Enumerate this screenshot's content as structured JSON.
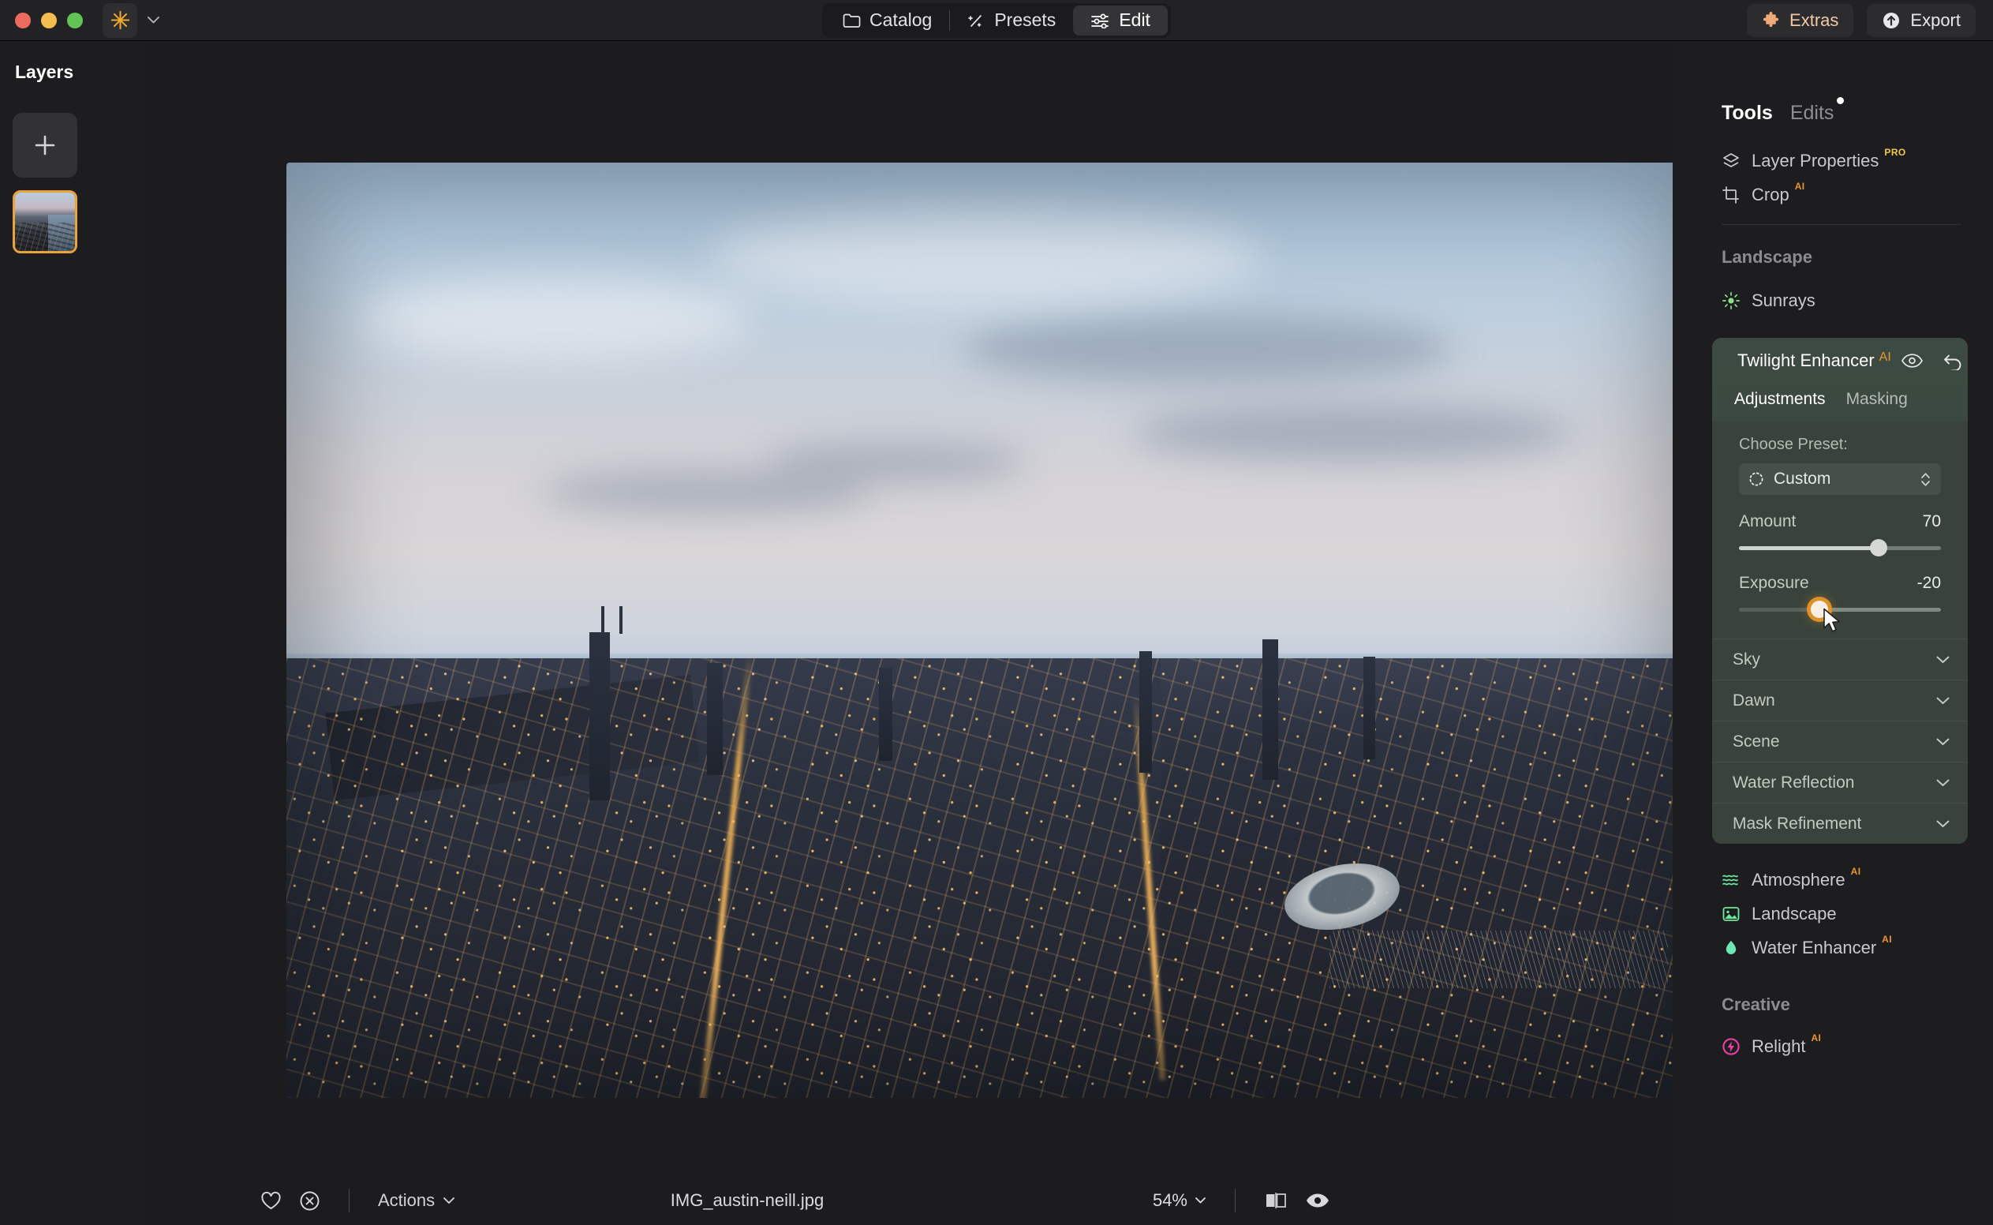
{
  "window": {
    "traffic_lights": [
      "close",
      "minimize",
      "zoom"
    ],
    "app_icon": "sparkle-icon",
    "app_menu_chevron": "chevron-down-icon"
  },
  "topnav": {
    "items": [
      {
        "label": "Catalog",
        "icon": "folder-icon",
        "active": false
      },
      {
        "label": "Presets",
        "icon": "wand-sparkle-icon",
        "active": false
      },
      {
        "label": "Edit",
        "icon": "sliders-icon",
        "active": true
      }
    ],
    "extras_label": "Extras",
    "extras_icon": "puzzle-piece-icon",
    "export_label": "Export",
    "export_icon": "upload-circle-icon"
  },
  "layers": {
    "title": "Layers",
    "add_label": "+",
    "add_name": "add-layer-button",
    "selected_layer_border": "#e8a33d"
  },
  "canvas": {
    "image_description": "Aerial twilight view of Chicago skyline with Lake Michigan"
  },
  "bottombar": {
    "favorite_icon": "heart-icon",
    "reject_icon": "reject-circle-icon",
    "actions_label": "Actions",
    "actions_chevron": "chevron-down-icon",
    "filename": "IMG_austin-neill.jpg",
    "zoom_level": "54%",
    "zoom_chevron": "chevron-down-icon",
    "compare_icon": "before-after-icon",
    "preview_icon": "eye-icon"
  },
  "right_panel": {
    "tabs": [
      {
        "label": "Tools",
        "active": true,
        "dot": false
      },
      {
        "label": "Edits",
        "active": false,
        "dot": true
      }
    ],
    "top_tools": [
      {
        "label": "Layer Properties",
        "badge": "PRO",
        "badge_type": "pro",
        "icon": "layers-icon"
      },
      {
        "label": "Crop",
        "badge": "AI",
        "badge_type": "ai",
        "icon": "crop-icon"
      }
    ],
    "landscape_section": {
      "title": "Landscape",
      "items": [
        {
          "label": "Sunrays",
          "badge": "",
          "icon": "sun-icon",
          "icon_color": "#8ce08c"
        }
      ]
    },
    "twilight_enhancer": {
      "title": "Twilight Enhancer",
      "badge": "AI",
      "icon": "twilight-icon",
      "header_icons": [
        "eye-icon",
        "reset-icon",
        "info-icon"
      ],
      "subtabs": [
        {
          "label": "Adjustments",
          "active": true
        },
        {
          "label": "Masking",
          "active": false
        }
      ],
      "preset_label": "Choose Preset:",
      "preset_value": "Custom",
      "preset_icon": "dotted-circle-icon",
      "preset_caret": "stepper-chevrons-icon",
      "sliders": [
        {
          "name": "Amount",
          "value": "70",
          "percent": 70,
          "active": false
        },
        {
          "name": "Exposure",
          "value": "-20",
          "percent": 40,
          "active": true
        }
      ],
      "sections": [
        {
          "label": "Sky",
          "expanded": false
        },
        {
          "label": "Dawn",
          "expanded": false
        },
        {
          "label": "Scene",
          "expanded": false
        },
        {
          "label": "Water Reflection",
          "expanded": false
        },
        {
          "label": "Mask Refinement",
          "expanded": false
        }
      ]
    },
    "more_tools": [
      {
        "label": "Atmosphere",
        "badge": "AI",
        "icon": "waves-icon",
        "icon_color": "#6ee7a0"
      },
      {
        "label": "Landscape",
        "badge": "",
        "icon": "image-icon",
        "icon_color": "#6ee7a0"
      },
      {
        "label": "Water Enhancer",
        "badge": "AI",
        "icon": "droplet-icon",
        "icon_color": "#6ee7b7"
      }
    ],
    "creative_section": {
      "title": "Creative",
      "items": [
        {
          "label": "Relight",
          "badge": "AI",
          "icon": "relight-bolt-icon",
          "icon_color": "#ea3fa8"
        }
      ]
    }
  },
  "colors": {
    "accent_orange": "#e8a33d",
    "panel_green": "#39433c",
    "badge_pro": "#f2c94c",
    "badge_ai": "#e8972e"
  }
}
